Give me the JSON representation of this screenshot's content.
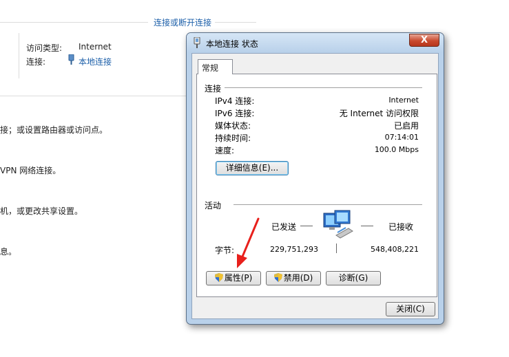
{
  "background": {
    "connect_link": "连接或断开连接",
    "access_type_label": "访问类型:",
    "access_type_value": "Internet",
    "connection_label": "连接:",
    "connection_value": "本地连接",
    "line1": "接；或设置路由器或访问点。",
    "line2": "VPN 网络连接。",
    "line3": "机，或更改共享设置。",
    "line4": "息。"
  },
  "dialog": {
    "title": "本地连接 状态",
    "close_label": "X",
    "tab_general": "常规",
    "connection_section": "连接",
    "rows": [
      {
        "label": "IPv4 连接:",
        "value": "Internet"
      },
      {
        "label": "IPv6 连接:",
        "value": "无 Internet 访问权限"
      },
      {
        "label": "媒体状态:",
        "value": "已启用"
      },
      {
        "label": "持续时间:",
        "value": "07:14:01"
      },
      {
        "label": "速度:",
        "value": "100.0 Mbps"
      }
    ],
    "details_button": "详细信息(E)...",
    "activity_section": "活动",
    "sent_label": "已发送",
    "received_label": "已接收",
    "bytes_label": "字节:",
    "bytes_sent": "229,751,293",
    "bytes_received": "548,408,221",
    "properties_button": "属性(P)",
    "disable_button": "禁用(D)",
    "diagnose_button": "诊断(G)",
    "close_button": "关闭(C)"
  },
  "colors": {
    "link": "#1c5fa9",
    "annotation_arrow": "#e8201c"
  },
  "icons": [
    "network-plug-icon",
    "network-computers-icon",
    "uac-shield-icon",
    "red-arrow-annotation"
  ]
}
